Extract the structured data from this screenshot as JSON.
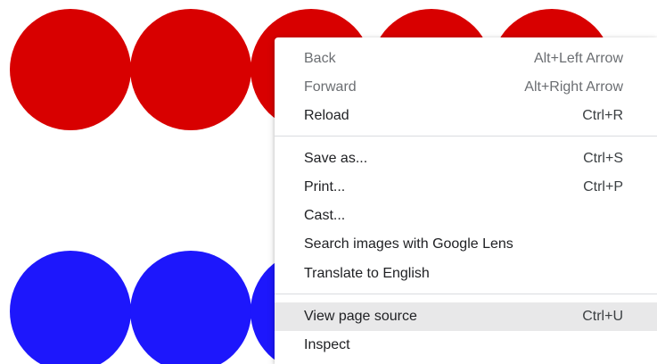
{
  "page": {
    "colors": {
      "red_circle": "#d80000",
      "blue_circle": "#1d17fc"
    }
  },
  "context_menu": {
    "items": [
      {
        "label": "Back",
        "shortcut": "Alt+Left Arrow",
        "disabled": true
      },
      {
        "label": "Forward",
        "shortcut": "Alt+Right Arrow",
        "disabled": true
      },
      {
        "label": "Reload",
        "shortcut": "Ctrl+R"
      },
      {
        "label": "Save as...",
        "shortcut": "Ctrl+S"
      },
      {
        "label": "Print...",
        "shortcut": "Ctrl+P"
      },
      {
        "label": "Cast..."
      },
      {
        "label": "Search images with Google Lens"
      },
      {
        "label": "Translate to English"
      },
      {
        "label": "View page source",
        "shortcut": "Ctrl+U",
        "highlighted": true
      },
      {
        "label": "Inspect"
      }
    ]
  }
}
